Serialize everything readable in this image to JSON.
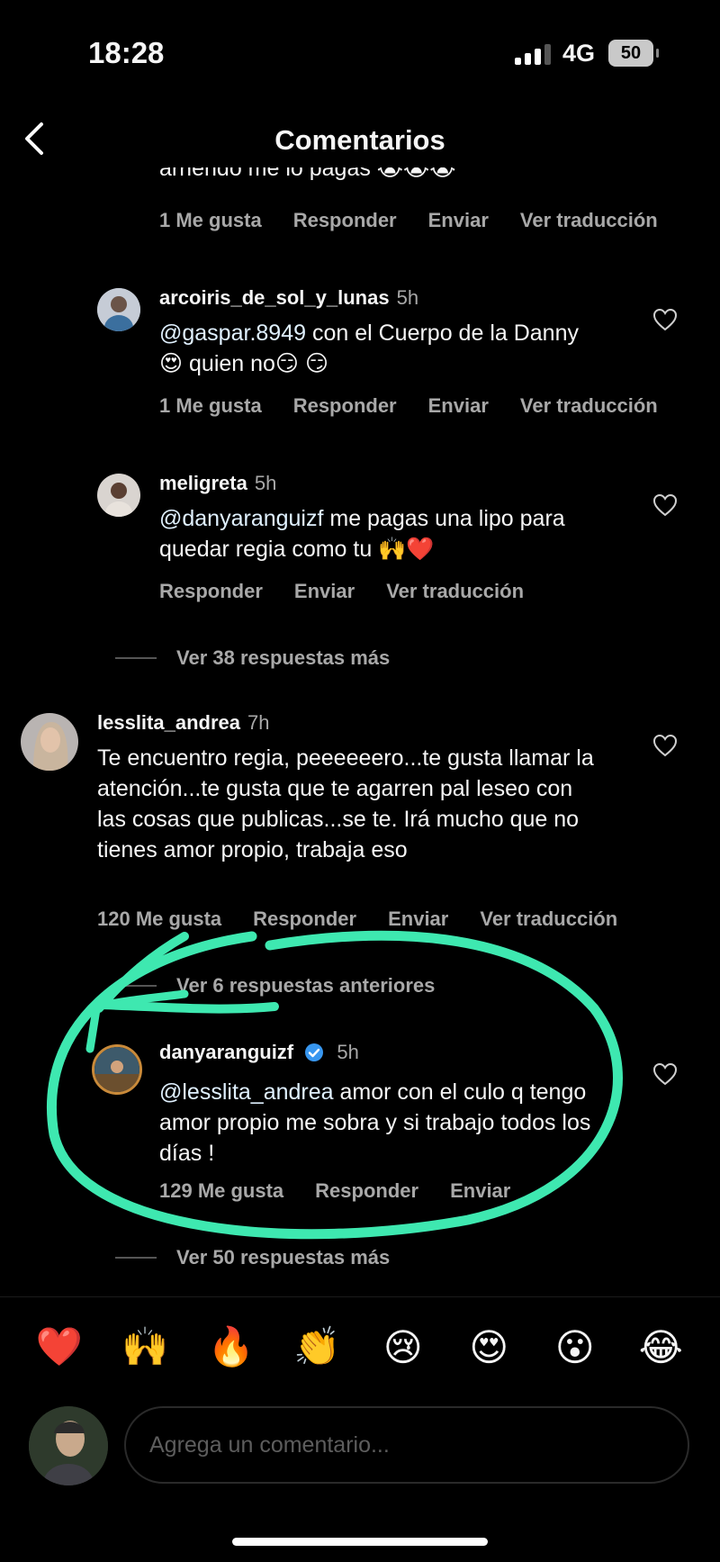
{
  "status_bar": {
    "time": "18:28",
    "network": "4G",
    "battery": "50"
  },
  "header": {
    "title": "Comentarios"
  },
  "partial_top": {
    "text": "arriendo me lo pagas 😭😭😭",
    "actions": {
      "likes": "1 Me gusta",
      "reply": "Responder",
      "send": "Enviar",
      "translate": "Ver traducción"
    }
  },
  "comments": [
    {
      "username": "arcoiris_de_sol_y_lunas",
      "age": "5h",
      "mention": "@gaspar.8949",
      "text": " con el Cuerpo de la Danny 😍 quien no😏 😏",
      "likes": "1 Me gusta",
      "reply": "Responder",
      "send": "Enviar",
      "translate": "Ver traducción"
    },
    {
      "username": "meligreta",
      "age": "5h",
      "mention": "@danyaranguizf",
      "text": " me pagas una lipo para quedar regia como tu 🙌❤️",
      "reply": "Responder",
      "send": "Enviar",
      "translate": "Ver traducción"
    },
    {
      "username": "lesslita_andrea",
      "age": "7h",
      "text": "Te encuentro regia, peeeeeero...te gusta llamar la atención...te gusta que te agarren pal leseo con las cosas que publicas...se te. Irá mucho que no tienes amor propio, trabaja eso",
      "likes": "120 Me gusta",
      "reply": "Responder",
      "send": "Enviar",
      "translate": "Ver traducción"
    },
    {
      "username": "danyaranguizf",
      "age": "5h",
      "verified": true,
      "mention": "@lesslita_andrea",
      "text": " amor con el culo q tengo amor propio me sobra y si trabajo todos los días !",
      "likes": "129 Me gusta",
      "reply": "Responder",
      "send": "Enviar"
    }
  ],
  "replies_links": {
    "more_38": "Ver 38 respuestas más",
    "previous": "Ver 6 respuestas anteriores",
    "more_50": "Ver 50 respuestas más"
  },
  "emoji_bar": [
    "❤️",
    "🙌",
    "🔥",
    "👏",
    "😢",
    "😍",
    "😮",
    "😂"
  ],
  "composer": {
    "placeholder": "Agrega un comentario..."
  },
  "colors": {
    "background": "#000000",
    "secondary_text": "#a8a8a8",
    "highlight": "#3ee8b0",
    "verified": "#3897f0"
  }
}
